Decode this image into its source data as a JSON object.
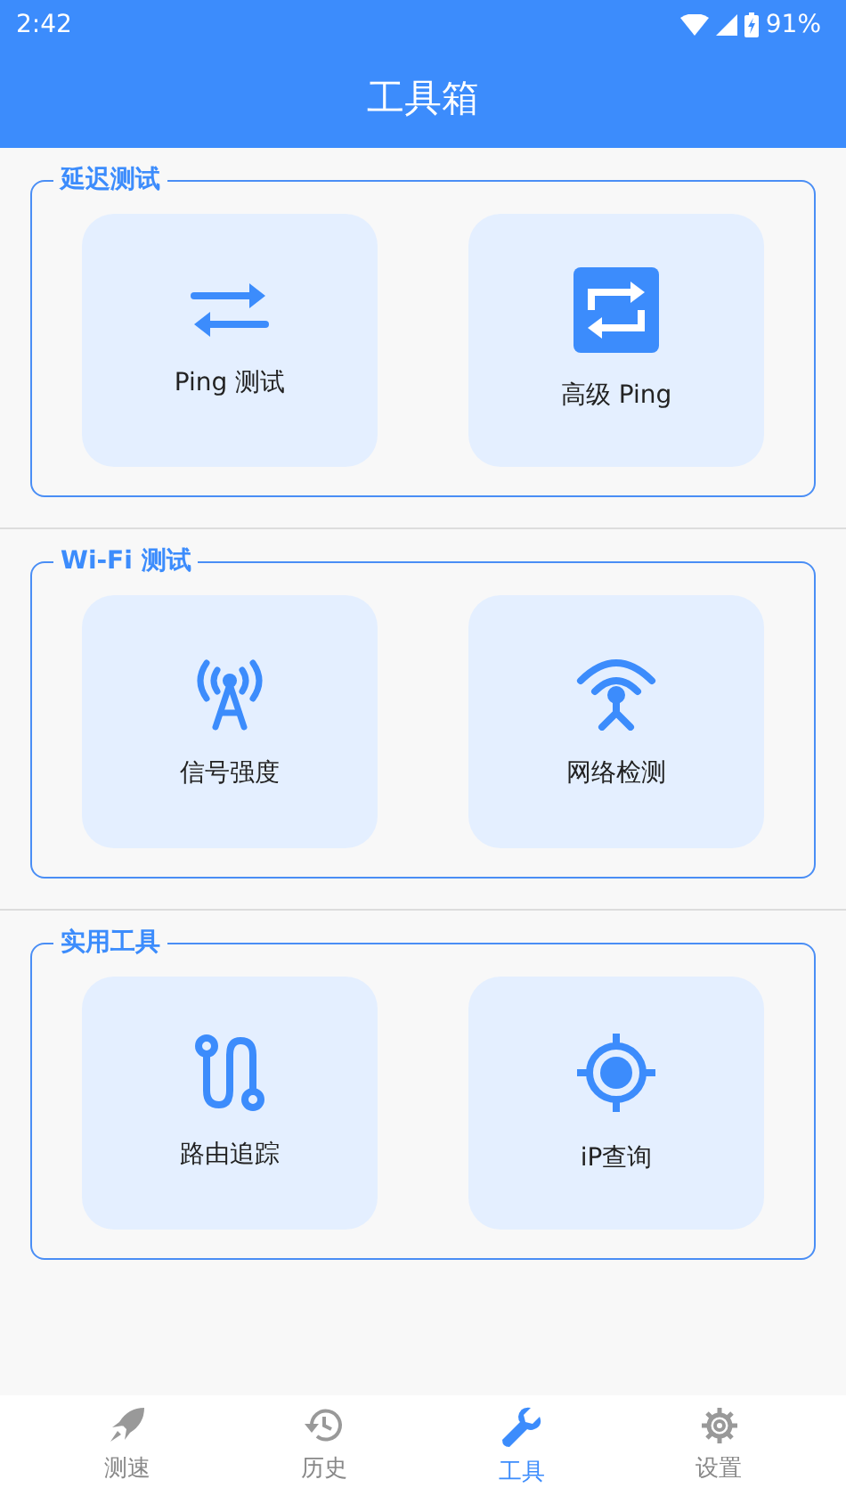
{
  "status_bar": {
    "time": "2:42",
    "battery": "91%"
  },
  "header": {
    "title": "工具箱"
  },
  "sections": [
    {
      "title": "延迟测试",
      "tools": [
        {
          "label": "Ping 测试",
          "kind": "swap"
        },
        {
          "label": "高级 Ping",
          "kind": "repeat"
        }
      ]
    },
    {
      "title": "Wi-Fi 测试",
      "tools": [
        {
          "label": "信号强度",
          "kind": "antenna"
        },
        {
          "label": "网络检测",
          "kind": "tower"
        }
      ]
    },
    {
      "title": "实用工具",
      "tools": [
        {
          "label": "路由追踪",
          "kind": "route"
        },
        {
          "label": "iP查询",
          "kind": "target"
        }
      ]
    }
  ],
  "bottom_nav": [
    {
      "label": "测速",
      "kind": "rocket",
      "selected": false
    },
    {
      "label": "历史",
      "kind": "history",
      "selected": false
    },
    {
      "label": "工具",
      "kind": "wrench",
      "selected": true
    },
    {
      "label": "设置",
      "kind": "gear",
      "selected": false
    }
  ]
}
